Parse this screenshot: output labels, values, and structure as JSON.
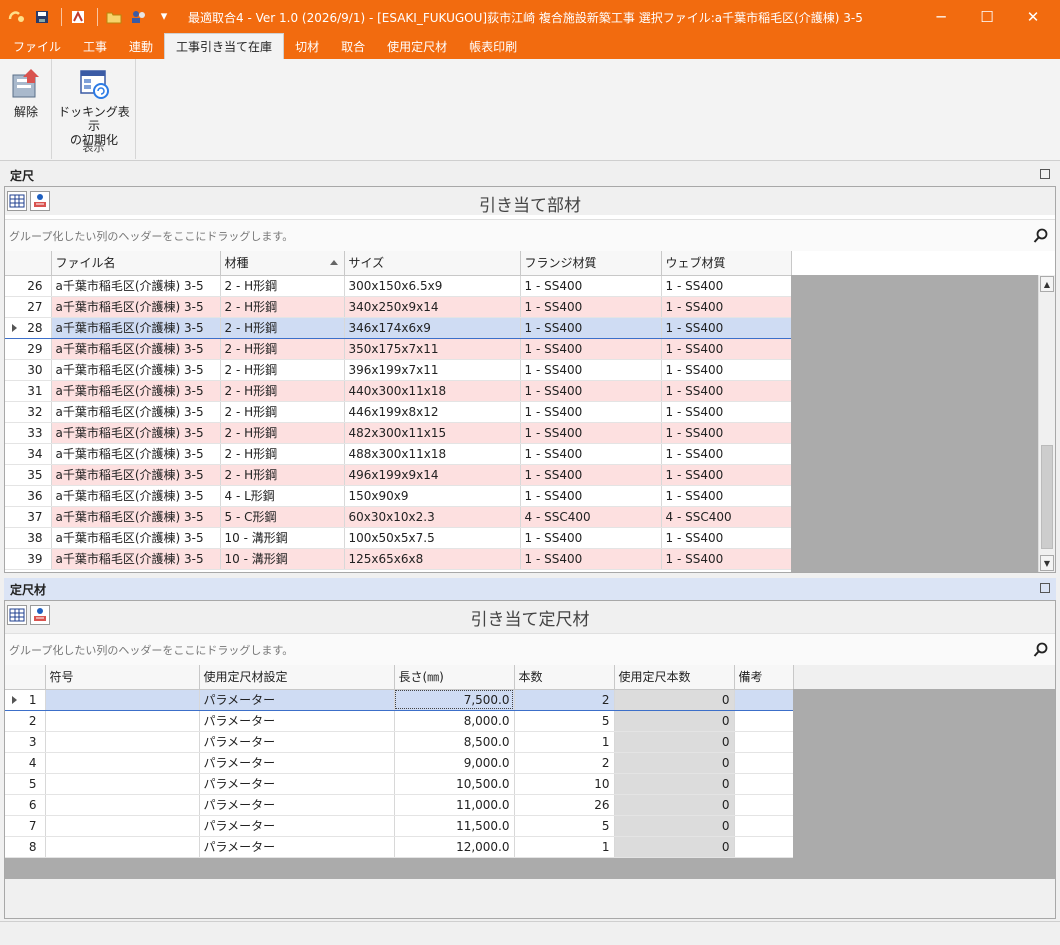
{
  "titlebar": {
    "title": "最適取合4  - Ver 1.0  (2026/9/1) - [ESAKI_FUKUGOU]荻市江崎 複合施設新築工事   選択ファイル:a千葉市稲毛区(介護棟) 3-5",
    "minimize": "─",
    "maximize": "☐",
    "close": "✕"
  },
  "menu": [
    "ファイル",
    "工事",
    "連動",
    "工事引き当て在庫",
    "切材",
    "取合",
    "使用定尺材",
    "帳表印刷"
  ],
  "ribbon": {
    "release_label": "解除",
    "docking_label_1": "ドッキング表示",
    "docking_label_2": "の初期化",
    "group_label": "表示"
  },
  "top_panel": {
    "header": "定尺",
    "grid_title": "引き当て部材",
    "group_hint": "グループ化したい列のヘッダーをここにドラッグします。",
    "columns": [
      "ファイル名",
      "材種",
      "サイズ",
      "フランジ材質",
      "ウェブ材質"
    ],
    "rows": [
      {
        "no": "26",
        "file": "a千葉市稲毛区(介護棟) 3-5",
        "kind": "2 - H形鋼",
        "size": "300x150x6.5x9",
        "flange": "1 - SS400",
        "web": "1 - SS400"
      },
      {
        "no": "27",
        "file": "a千葉市稲毛区(介護棟) 3-5",
        "kind": "2 - H形鋼",
        "size": "340x250x9x14",
        "flange": "1 - SS400",
        "web": "1 - SS400"
      },
      {
        "no": "28",
        "file": "a千葉市稲毛区(介護棟) 3-5",
        "kind": "2 - H形鋼",
        "size": "346x174x6x9",
        "flange": "1 - SS400",
        "web": "1 - SS400"
      },
      {
        "no": "29",
        "file": "a千葉市稲毛区(介護棟) 3-5",
        "kind": "2 - H形鋼",
        "size": "350x175x7x11",
        "flange": "1 - SS400",
        "web": "1 - SS400"
      },
      {
        "no": "30",
        "file": "a千葉市稲毛区(介護棟) 3-5",
        "kind": "2 - H形鋼",
        "size": "396x199x7x11",
        "flange": "1 - SS400",
        "web": "1 - SS400"
      },
      {
        "no": "31",
        "file": "a千葉市稲毛区(介護棟) 3-5",
        "kind": "2 - H形鋼",
        "size": "440x300x11x18",
        "flange": "1 - SS400",
        "web": "1 - SS400"
      },
      {
        "no": "32",
        "file": "a千葉市稲毛区(介護棟) 3-5",
        "kind": "2 - H形鋼",
        "size": "446x199x8x12",
        "flange": "1 - SS400",
        "web": "1 - SS400"
      },
      {
        "no": "33",
        "file": "a千葉市稲毛区(介護棟) 3-5",
        "kind": "2 - H形鋼",
        "size": "482x300x11x15",
        "flange": "1 - SS400",
        "web": "1 - SS400"
      },
      {
        "no": "34",
        "file": "a千葉市稲毛区(介護棟) 3-5",
        "kind": "2 - H形鋼",
        "size": "488x300x11x18",
        "flange": "1 - SS400",
        "web": "1 - SS400"
      },
      {
        "no": "35",
        "file": "a千葉市稲毛区(介護棟) 3-5",
        "kind": "2 - H形鋼",
        "size": "496x199x9x14",
        "flange": "1 - SS400",
        "web": "1 - SS400"
      },
      {
        "no": "36",
        "file": "a千葉市稲毛区(介護棟) 3-5",
        "kind": "4 - L形鋼",
        "size": "150x90x9",
        "flange": "1 - SS400",
        "web": "1 - SS400"
      },
      {
        "no": "37",
        "file": "a千葉市稲毛区(介護棟) 3-5",
        "kind": "5 - C形鋼",
        "size": "60x30x10x2.3",
        "flange": "4 - SSC400",
        "web": "4 - SSC400"
      },
      {
        "no": "38",
        "file": "a千葉市稲毛区(介護棟) 3-5",
        "kind": "10 - 溝形鋼",
        "size": "100x50x5x7.5",
        "flange": "1 - SS400",
        "web": "1 - SS400"
      },
      {
        "no": "39",
        "file": "a千葉市稲毛区(介護棟) 3-5",
        "kind": "10 - 溝形鋼",
        "size": "125x65x6x8",
        "flange": "1 - SS400",
        "web": "1 - SS400"
      }
    ]
  },
  "bottom_panel": {
    "header": "定尺材",
    "grid_title": "引き当て定尺材",
    "group_hint": "グループ化したい列のヘッダーをここにドラッグします。",
    "columns": [
      "符号",
      "使用定尺材設定",
      "長さ(㎜)",
      "本数",
      "使用定尺本数",
      "備考"
    ],
    "rows": [
      {
        "no": "1",
        "code": "",
        "setting": "パラメーター",
        "length": "7,500.0",
        "count": "2",
        "used": "0",
        "note": ""
      },
      {
        "no": "2",
        "code": "",
        "setting": "パラメーター",
        "length": "8,000.0",
        "count": "5",
        "used": "0",
        "note": ""
      },
      {
        "no": "3",
        "code": "",
        "setting": "パラメーター",
        "length": "8,500.0",
        "count": "1",
        "used": "0",
        "note": ""
      },
      {
        "no": "4",
        "code": "",
        "setting": "パラメーター",
        "length": "9,000.0",
        "count": "2",
        "used": "0",
        "note": ""
      },
      {
        "no": "5",
        "code": "",
        "setting": "パラメーター",
        "length": "10,500.0",
        "count": "10",
        "used": "0",
        "note": ""
      },
      {
        "no": "6",
        "code": "",
        "setting": "パラメーター",
        "length": "11,000.0",
        "count": "26",
        "used": "0",
        "note": ""
      },
      {
        "no": "7",
        "code": "",
        "setting": "パラメーター",
        "length": "11,500.0",
        "count": "5",
        "used": "0",
        "note": ""
      },
      {
        "no": "8",
        "code": "",
        "setting": "パラメーター",
        "length": "12,000.0",
        "count": "1",
        "used": "0",
        "note": ""
      }
    ]
  },
  "colors": {
    "accent": "#f26b0f",
    "alt_row": "#fde0e0",
    "selected_row": "#cfdcf3"
  }
}
